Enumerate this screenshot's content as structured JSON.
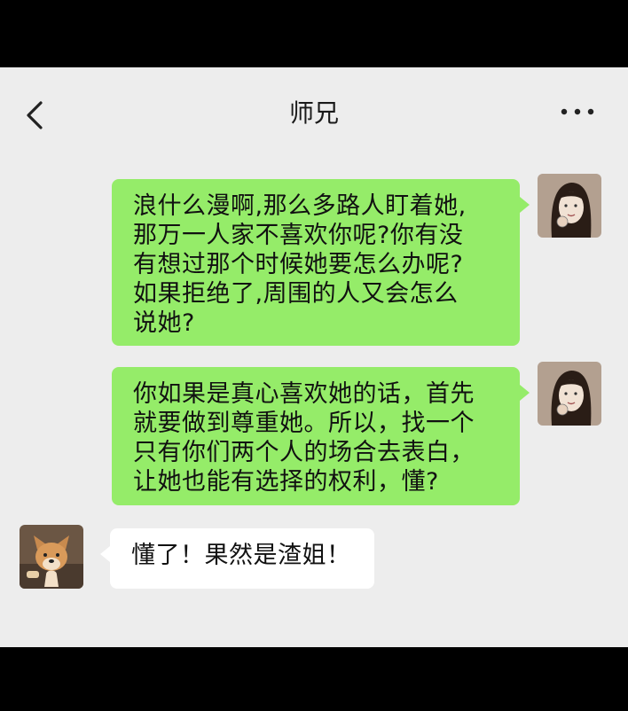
{
  "header": {
    "title": "师兄",
    "back_icon": "chevron-left-icon",
    "more_icon": "more-horizontal-icon"
  },
  "messages": [
    {
      "from": "me",
      "text": "浪什么漫啊,那么多路人盯着她,\n那万一人家不喜欢你呢?你有没\n有想过那个时候她要怎么办呢?\n如果拒绝了,周围的人又会怎么\n说她?"
    },
    {
      "from": "me",
      "text": "你如果是真心喜欢她的话，首先\n就要做到尊重她。所以，找一个\n只有你们两个人的场合去表白，\n让她也能有选择的权利，懂?"
    },
    {
      "from": "other",
      "text": "懂了！果然是渣姐！"
    }
  ],
  "colors": {
    "background": "#ededed",
    "my_bubble": "#95ec69",
    "their_bubble": "#ffffff"
  }
}
